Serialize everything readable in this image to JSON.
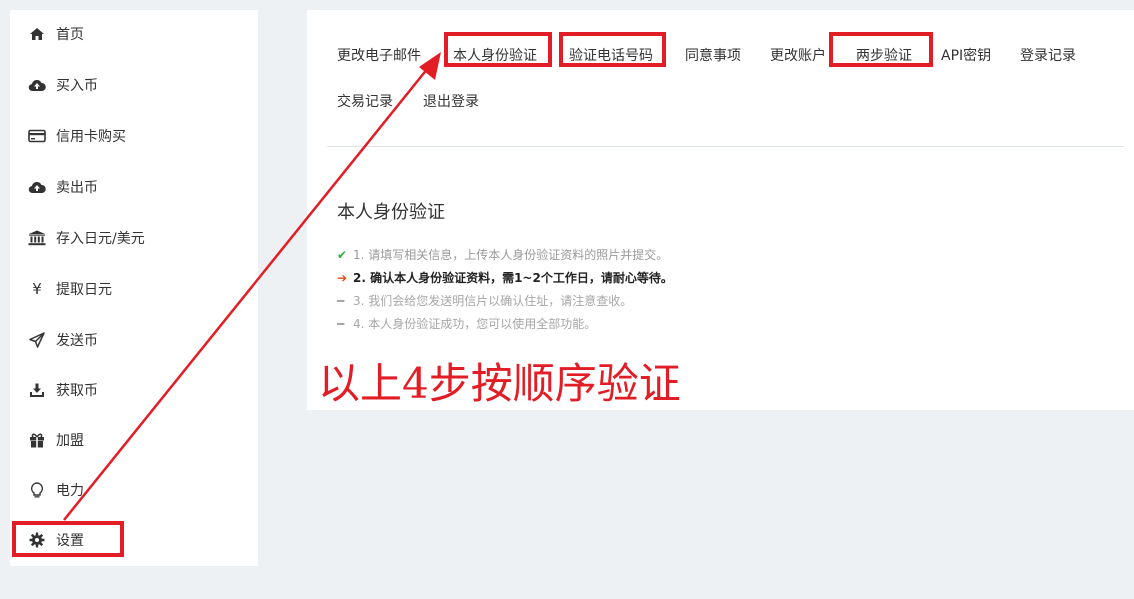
{
  "sidebar": {
    "items": [
      {
        "label": "首页",
        "icon": "home-icon"
      },
      {
        "label": "买入币",
        "icon": "cloud-upload-icon"
      },
      {
        "label": "信用卡购买",
        "icon": "credit-card-icon"
      },
      {
        "label": "卖出币",
        "icon": "cloud-upload-icon"
      },
      {
        "label": "存入日元/美元",
        "icon": "bank-icon"
      },
      {
        "label": "提取日元",
        "icon": "yen-icon"
      },
      {
        "label": "发送币",
        "icon": "send-icon"
      },
      {
        "label": "获取币",
        "icon": "download-icon"
      },
      {
        "label": "加盟",
        "icon": "gift-icon"
      },
      {
        "label": "电力",
        "icon": "lightbulb-icon"
      },
      {
        "label": "设置",
        "icon": "gear-icon"
      }
    ]
  },
  "tabs": [
    {
      "label": "更改电子邮件"
    },
    {
      "label": "本人身份验证"
    },
    {
      "label": "验证电话号码"
    },
    {
      "label": "同意事项"
    },
    {
      "label": "更改账户"
    },
    {
      "label": "两步验证"
    },
    {
      "label": "API密钥"
    },
    {
      "label": "登录记录"
    },
    {
      "label": "交易记录"
    },
    {
      "label": "退出登录"
    }
  ],
  "identity": {
    "title": "本人身份验证",
    "steps": [
      {
        "mark": "✔",
        "text": "1. 请填写相关信息，上传本人身份验证资料的照片并提交。",
        "state": "done"
      },
      {
        "mark": "➔",
        "text": "2. 确认本人身份验证资料，需1~2个工作日，请耐心等待。",
        "state": "current"
      },
      {
        "mark": "━",
        "text": "3. 我们会给您发送明信片以确认住址，请注意查收。",
        "state": "todo"
      },
      {
        "mark": "━",
        "text": "4. 本人身份验证成功，您可以使用全部功能。",
        "state": "todo"
      }
    ]
  },
  "annotation": {
    "text": "以上4步按顺序验证",
    "color": "#e21d25"
  },
  "colors": {
    "highlight": "#e21d25",
    "done": "#2fae3f",
    "current": "#e8491d"
  }
}
